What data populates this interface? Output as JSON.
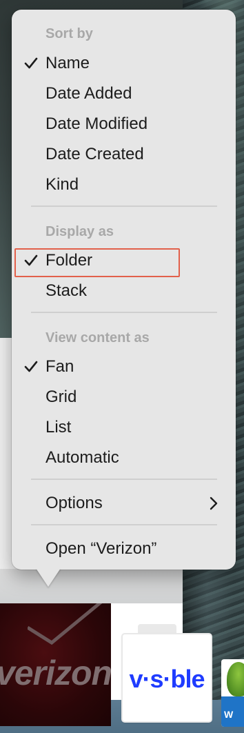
{
  "menu": {
    "sort_by": {
      "heading": "Sort by",
      "items": [
        {
          "label": "Name",
          "checked": true
        },
        {
          "label": "Date Added",
          "checked": false
        },
        {
          "label": "Date Modified",
          "checked": false
        },
        {
          "label": "Date Created",
          "checked": false
        },
        {
          "label": "Kind",
          "checked": false
        }
      ]
    },
    "display_as": {
      "heading": "Display as",
      "items": [
        {
          "label": "Folder",
          "checked": true
        },
        {
          "label": "Stack",
          "checked": false
        }
      ]
    },
    "view_content_as": {
      "heading": "View content as",
      "items": [
        {
          "label": "Fan",
          "checked": true
        },
        {
          "label": "Grid",
          "checked": false
        },
        {
          "label": "List",
          "checked": false
        },
        {
          "label": "Automatic",
          "checked": false
        }
      ]
    },
    "options_label": "Options",
    "open_label": "Open “Verizon”",
    "icons": {
      "check": "checkmark-icon",
      "submenu": "chevron-right-icon"
    }
  },
  "dock": {
    "verizon_icon_text": "verizon",
    "visible_icon_text": "v·s·ble",
    "geico_icon_text": "W"
  },
  "colors": {
    "menu_bg": "#e6e6e6",
    "heading_text": "#a8a8a8",
    "item_text": "#1c1c1c",
    "highlight_outline": "#e2604a",
    "visible_brand": "#1f3cff"
  }
}
